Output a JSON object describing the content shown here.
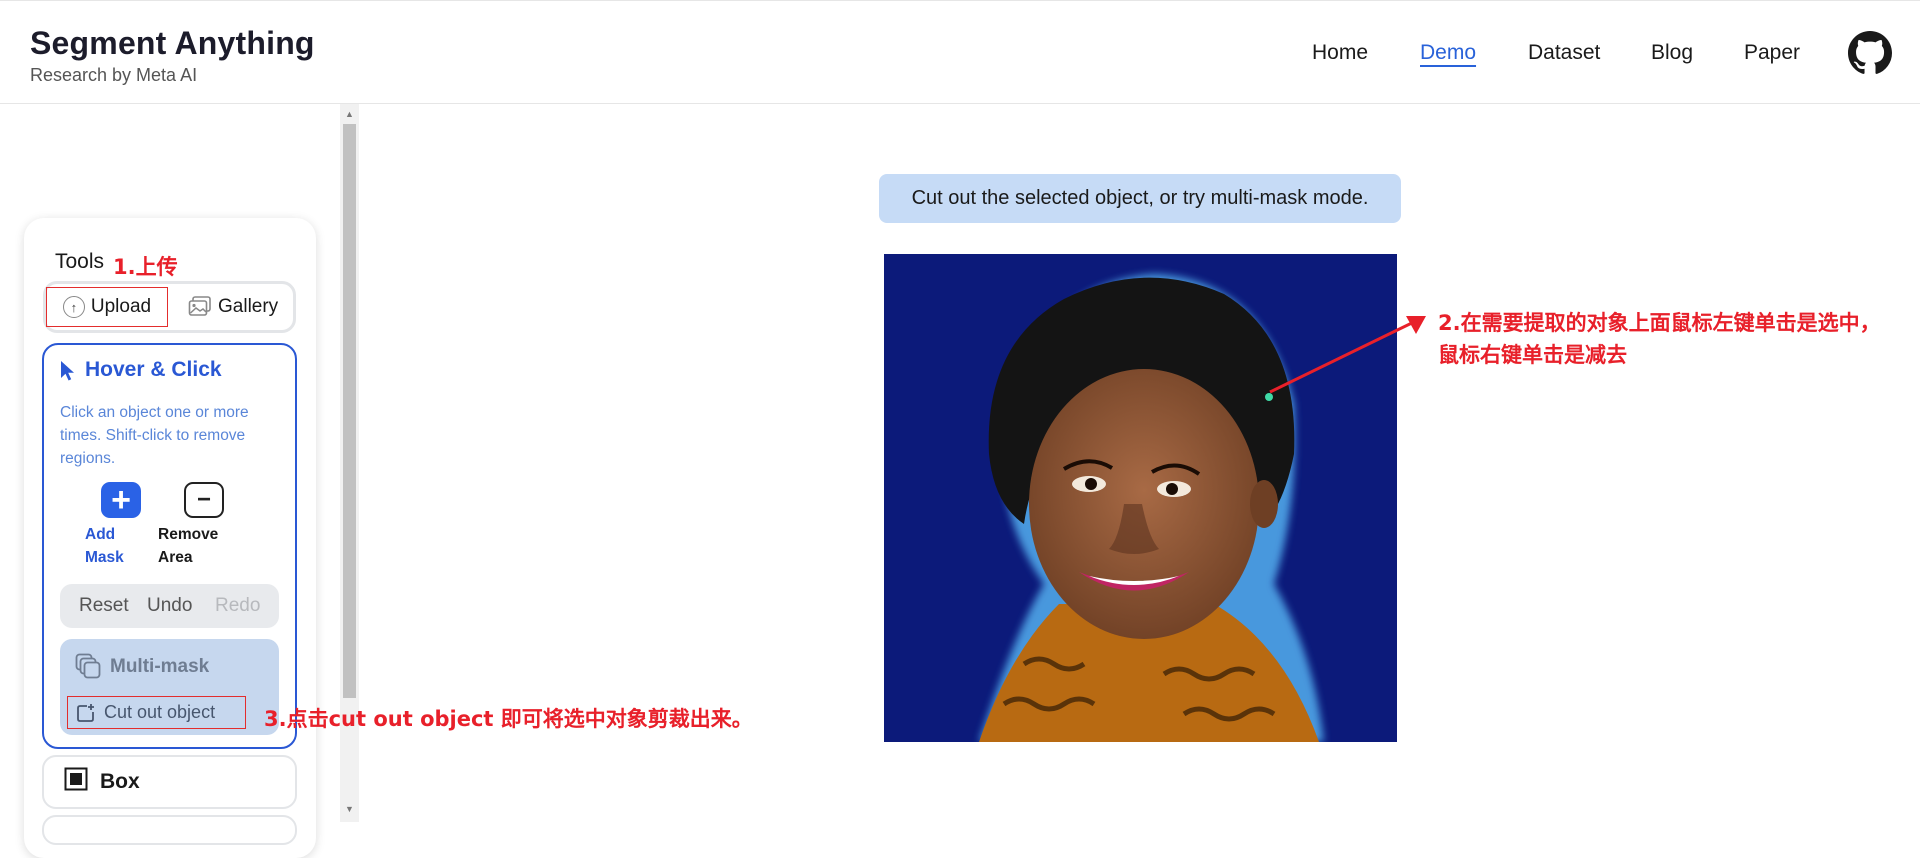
{
  "header": {
    "title": "Segment Anything",
    "subtitle": "Research by Meta AI",
    "nav": [
      {
        "label": "Home"
      },
      {
        "label": "Demo"
      },
      {
        "label": "Dataset"
      },
      {
        "label": "Blog"
      },
      {
        "label": "Paper"
      }
    ],
    "github_icon": "github-icon"
  },
  "tools": {
    "title": "Tools",
    "upload_label": "Upload",
    "gallery_label": "Gallery",
    "hover_click": {
      "title": "Hover & Click",
      "description": "Click an object one or more times. Shift-click to remove regions.",
      "add_mask_label": "Add Mask",
      "remove_area_label": "Remove Area"
    },
    "actions": {
      "reset": "Reset",
      "undo": "Undo",
      "redo": "Redo"
    },
    "multimask": {
      "label": "Multi-mask",
      "cut_out_label": "Cut out object"
    },
    "box_label": "Box"
  },
  "canvas": {
    "hint": "Cut out the selected object, or try multi-mask mode."
  },
  "annotations": {
    "step1": "1.上传",
    "step2_line1": "2.在需要提取的对象上面鼠标左键单击是选中，",
    "step2_line2": "鼠标右键单击是减去",
    "step3": "3.点击cut out object 即可将选中对象剪裁出来。"
  },
  "colors": {
    "accent_blue": "#2a58d4",
    "annotation_red": "#e8202a",
    "photo_background": "#0c1a7a",
    "hint_background": "#c6dbf6"
  }
}
